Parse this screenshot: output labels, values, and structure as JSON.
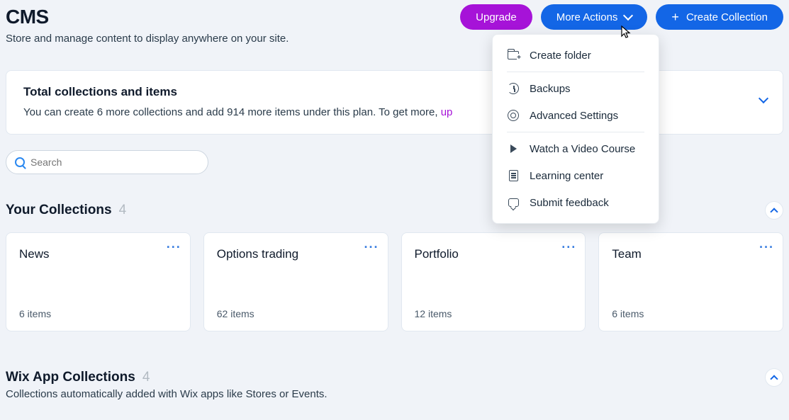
{
  "page": {
    "title": "CMS",
    "subtitle": "Store and manage content to display anywhere on your site."
  },
  "header_buttons": {
    "upgrade": "Upgrade",
    "more_actions": "More Actions",
    "create_collection": "Create Collection"
  },
  "info_card": {
    "title": "Total collections and items",
    "text_prefix": "You can create 6 more collections and add 914 more items under this plan. To get more, ",
    "upgrade_link": "up"
  },
  "search": {
    "placeholder": "Search"
  },
  "your_collections": {
    "title": "Your Collections",
    "count": "4",
    "items": [
      {
        "name": "News",
        "items": "6 items"
      },
      {
        "name": "Options trading",
        "items": "62 items"
      },
      {
        "name": "Portfolio",
        "items": "12 items"
      },
      {
        "name": "Team",
        "items": "6 items"
      }
    ]
  },
  "wix_app": {
    "title": "Wix App Collections",
    "count": "4",
    "subtitle": "Collections automatically added with Wix apps like Stores or Events."
  },
  "dropdown": {
    "create_folder": "Create folder",
    "backups": "Backups",
    "advanced": "Advanced Settings",
    "video": "Watch a Video Course",
    "learning": "Learning center",
    "feedback": "Submit feedback"
  }
}
